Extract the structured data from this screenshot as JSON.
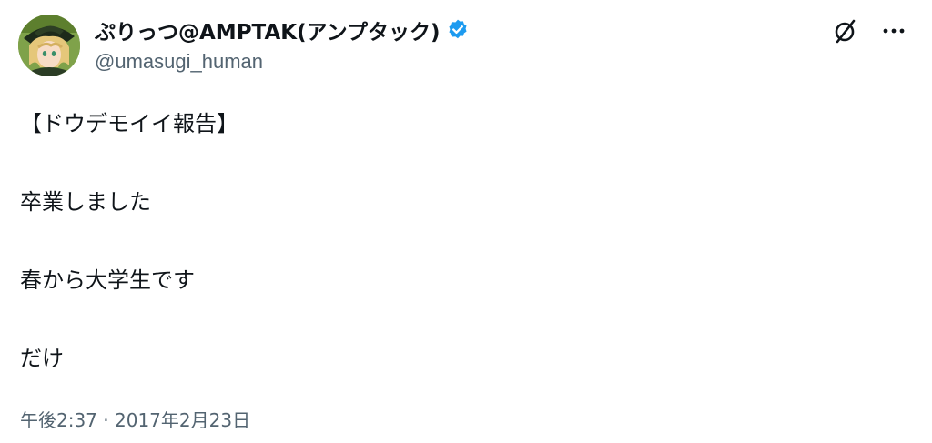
{
  "author": {
    "display_name": "ぷりっつ@AMPTAK(アンプタック)",
    "handle": "@umasugi_human",
    "verified": true,
    "avatar_icon": "avatar-image",
    "verified_color": "#1d9bf0"
  },
  "actions": {
    "grok_icon": "slashed-circle-icon",
    "more_icon": "more-dots-icon"
  },
  "tweet": {
    "lines": [
      "【ドウデモイイ報告】",
      "卒業しました",
      "春から大学生です",
      "だけ"
    ],
    "time": "午後2:37",
    "separator": "·",
    "date": "2017年2月23日"
  },
  "colors": {
    "text": "#0f1419",
    "secondary": "#536471"
  }
}
